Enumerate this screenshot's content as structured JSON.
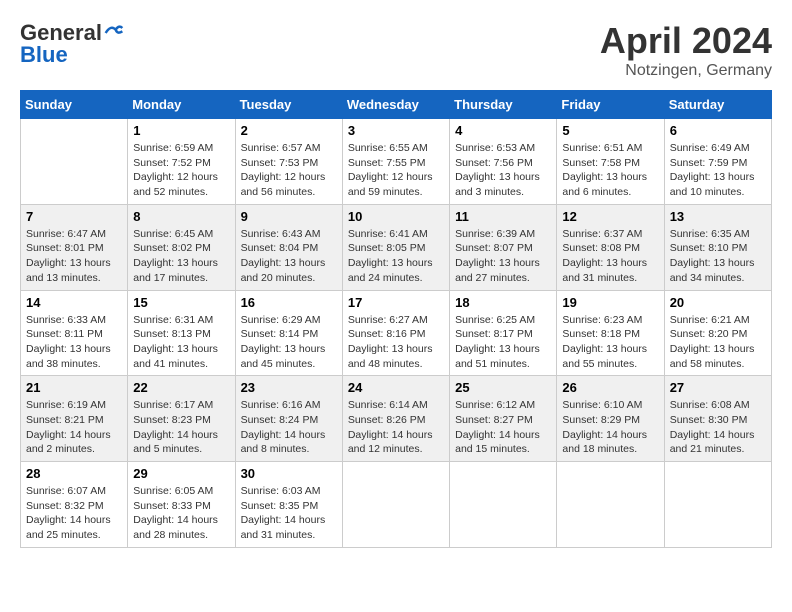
{
  "header": {
    "logo_general": "General",
    "logo_blue": "Blue",
    "title": "April 2024",
    "location": "Notzingen, Germany"
  },
  "days_of_week": [
    "Sunday",
    "Monday",
    "Tuesday",
    "Wednesday",
    "Thursday",
    "Friday",
    "Saturday"
  ],
  "weeks": [
    [
      {
        "day": "",
        "sunrise": "",
        "sunset": "",
        "daylight": ""
      },
      {
        "day": "1",
        "sunrise": "Sunrise: 6:59 AM",
        "sunset": "Sunset: 7:52 PM",
        "daylight": "Daylight: 12 hours and 52 minutes."
      },
      {
        "day": "2",
        "sunrise": "Sunrise: 6:57 AM",
        "sunset": "Sunset: 7:53 PM",
        "daylight": "Daylight: 12 hours and 56 minutes."
      },
      {
        "day": "3",
        "sunrise": "Sunrise: 6:55 AM",
        "sunset": "Sunset: 7:55 PM",
        "daylight": "Daylight: 12 hours and 59 minutes."
      },
      {
        "day": "4",
        "sunrise": "Sunrise: 6:53 AM",
        "sunset": "Sunset: 7:56 PM",
        "daylight": "Daylight: 13 hours and 3 minutes."
      },
      {
        "day": "5",
        "sunrise": "Sunrise: 6:51 AM",
        "sunset": "Sunset: 7:58 PM",
        "daylight": "Daylight: 13 hours and 6 minutes."
      },
      {
        "day": "6",
        "sunrise": "Sunrise: 6:49 AM",
        "sunset": "Sunset: 7:59 PM",
        "daylight": "Daylight: 13 hours and 10 minutes."
      }
    ],
    [
      {
        "day": "7",
        "sunrise": "Sunrise: 6:47 AM",
        "sunset": "Sunset: 8:01 PM",
        "daylight": "Daylight: 13 hours and 13 minutes."
      },
      {
        "day": "8",
        "sunrise": "Sunrise: 6:45 AM",
        "sunset": "Sunset: 8:02 PM",
        "daylight": "Daylight: 13 hours and 17 minutes."
      },
      {
        "day": "9",
        "sunrise": "Sunrise: 6:43 AM",
        "sunset": "Sunset: 8:04 PM",
        "daylight": "Daylight: 13 hours and 20 minutes."
      },
      {
        "day": "10",
        "sunrise": "Sunrise: 6:41 AM",
        "sunset": "Sunset: 8:05 PM",
        "daylight": "Daylight: 13 hours and 24 minutes."
      },
      {
        "day": "11",
        "sunrise": "Sunrise: 6:39 AM",
        "sunset": "Sunset: 8:07 PM",
        "daylight": "Daylight: 13 hours and 27 minutes."
      },
      {
        "day": "12",
        "sunrise": "Sunrise: 6:37 AM",
        "sunset": "Sunset: 8:08 PM",
        "daylight": "Daylight: 13 hours and 31 minutes."
      },
      {
        "day": "13",
        "sunrise": "Sunrise: 6:35 AM",
        "sunset": "Sunset: 8:10 PM",
        "daylight": "Daylight: 13 hours and 34 minutes."
      }
    ],
    [
      {
        "day": "14",
        "sunrise": "Sunrise: 6:33 AM",
        "sunset": "Sunset: 8:11 PM",
        "daylight": "Daylight: 13 hours and 38 minutes."
      },
      {
        "day": "15",
        "sunrise": "Sunrise: 6:31 AM",
        "sunset": "Sunset: 8:13 PM",
        "daylight": "Daylight: 13 hours and 41 minutes."
      },
      {
        "day": "16",
        "sunrise": "Sunrise: 6:29 AM",
        "sunset": "Sunset: 8:14 PM",
        "daylight": "Daylight: 13 hours and 45 minutes."
      },
      {
        "day": "17",
        "sunrise": "Sunrise: 6:27 AM",
        "sunset": "Sunset: 8:16 PM",
        "daylight": "Daylight: 13 hours and 48 minutes."
      },
      {
        "day": "18",
        "sunrise": "Sunrise: 6:25 AM",
        "sunset": "Sunset: 8:17 PM",
        "daylight": "Daylight: 13 hours and 51 minutes."
      },
      {
        "day": "19",
        "sunrise": "Sunrise: 6:23 AM",
        "sunset": "Sunset: 8:18 PM",
        "daylight": "Daylight: 13 hours and 55 minutes."
      },
      {
        "day": "20",
        "sunrise": "Sunrise: 6:21 AM",
        "sunset": "Sunset: 8:20 PM",
        "daylight": "Daylight: 13 hours and 58 minutes."
      }
    ],
    [
      {
        "day": "21",
        "sunrise": "Sunrise: 6:19 AM",
        "sunset": "Sunset: 8:21 PM",
        "daylight": "Daylight: 14 hours and 2 minutes."
      },
      {
        "day": "22",
        "sunrise": "Sunrise: 6:17 AM",
        "sunset": "Sunset: 8:23 PM",
        "daylight": "Daylight: 14 hours and 5 minutes."
      },
      {
        "day": "23",
        "sunrise": "Sunrise: 6:16 AM",
        "sunset": "Sunset: 8:24 PM",
        "daylight": "Daylight: 14 hours and 8 minutes."
      },
      {
        "day": "24",
        "sunrise": "Sunrise: 6:14 AM",
        "sunset": "Sunset: 8:26 PM",
        "daylight": "Daylight: 14 hours and 12 minutes."
      },
      {
        "day": "25",
        "sunrise": "Sunrise: 6:12 AM",
        "sunset": "Sunset: 8:27 PM",
        "daylight": "Daylight: 14 hours and 15 minutes."
      },
      {
        "day": "26",
        "sunrise": "Sunrise: 6:10 AM",
        "sunset": "Sunset: 8:29 PM",
        "daylight": "Daylight: 14 hours and 18 minutes."
      },
      {
        "day": "27",
        "sunrise": "Sunrise: 6:08 AM",
        "sunset": "Sunset: 8:30 PM",
        "daylight": "Daylight: 14 hours and 21 minutes."
      }
    ],
    [
      {
        "day": "28",
        "sunrise": "Sunrise: 6:07 AM",
        "sunset": "Sunset: 8:32 PM",
        "daylight": "Daylight: 14 hours and 25 minutes."
      },
      {
        "day": "29",
        "sunrise": "Sunrise: 6:05 AM",
        "sunset": "Sunset: 8:33 PM",
        "daylight": "Daylight: 14 hours and 28 minutes."
      },
      {
        "day": "30",
        "sunrise": "Sunrise: 6:03 AM",
        "sunset": "Sunset: 8:35 PM",
        "daylight": "Daylight: 14 hours and 31 minutes."
      },
      {
        "day": "",
        "sunrise": "",
        "sunset": "",
        "daylight": ""
      },
      {
        "day": "",
        "sunrise": "",
        "sunset": "",
        "daylight": ""
      },
      {
        "day": "",
        "sunrise": "",
        "sunset": "",
        "daylight": ""
      },
      {
        "day": "",
        "sunrise": "",
        "sunset": "",
        "daylight": ""
      }
    ]
  ]
}
